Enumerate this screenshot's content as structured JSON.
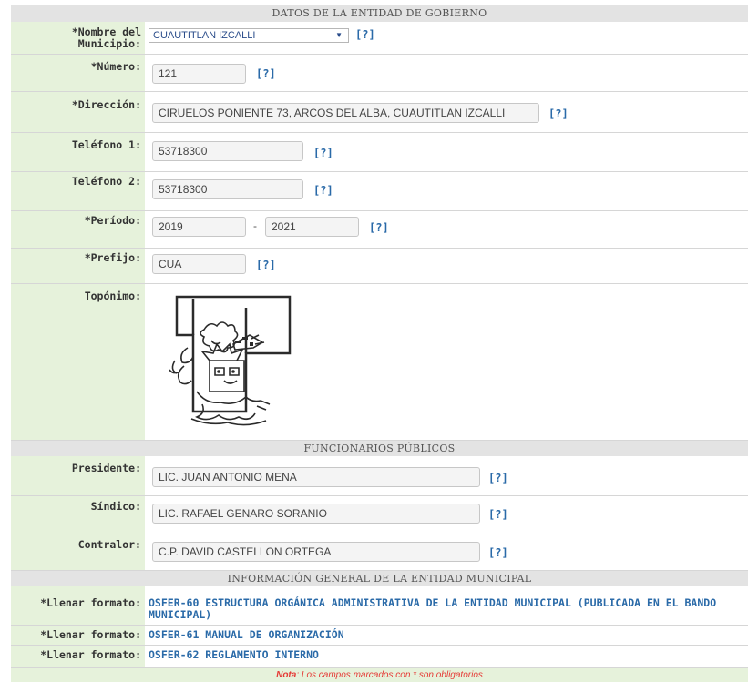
{
  "section_entity": {
    "title": "DATOS DE LA ENTIDAD DE GOBIERNO",
    "municipio_label": "*Nombre del Municipio:",
    "municipio_value": "CUAUTITLAN IZCALLI",
    "numero_label": "*Número:",
    "numero_value": "121",
    "direccion_label": "*Dirección:",
    "direccion_value": "CIRUELOS PONIENTE 73, ARCOS DEL ALBA, CUAUTITLAN IZCALLI",
    "telefono1_label": "Teléfono 1:",
    "telefono1_value": "53718300",
    "telefono2_label": "Teléfono 2:",
    "telefono2_value": "53718300",
    "periodo_label": "*Período:",
    "periodo_from": "2019",
    "periodo_sep": "-",
    "periodo_to": "2021",
    "prefijo_label": "*Prefijo:",
    "prefijo_value": "CUA",
    "toponimo_label": "Topónimo:",
    "help": "[?]"
  },
  "section_officials": {
    "title": "FUNCIONARIOS PÚBLICOS",
    "presidente_label": "Presidente:",
    "presidente_value": "LIC. JUAN ANTONIO MENA",
    "sindico_label": "Síndico:",
    "sindico_value": "LIC. RAFAEL GENARO SORANIO",
    "contralor_label": "Contralor:",
    "contralor_value": "C.P. DAVID CASTELLON ORTEGA"
  },
  "section_general": {
    "title": "INFORMACIÓN GENERAL DE LA ENTIDAD MUNICIPAL",
    "items": [
      {
        "label": "*Llenar formato:",
        "link": "OSFER-60 ESTRUCTURA ORGÁNICA ADMINISTRATIVA DE LA ENTIDAD MUNICIPAL (PUBLICADA EN EL BANDO MUNICIPAL)"
      },
      {
        "label": "*Llenar formato:",
        "link": "OSFER-61 MANUAL DE ORGANIZACIÓN"
      },
      {
        "label": "*Llenar formato:",
        "link": "OSFER-62 REGLAMENTO INTERNO"
      }
    ]
  },
  "footer": {
    "note_label": "Nota",
    "note_text": ": Los campos marcados con * son obligatorios"
  },
  "colors": {
    "label_bg": "#e6f2db",
    "header_bg": "#e3e3e3",
    "link": "#2a6aa8",
    "note": "#e53935"
  }
}
